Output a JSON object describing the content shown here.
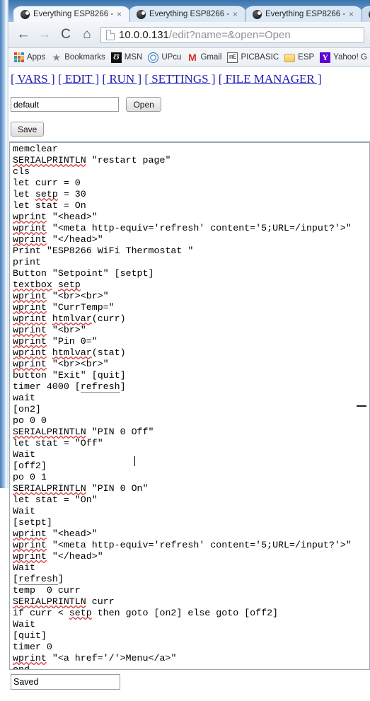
{
  "window": {
    "tabs": [
      {
        "title": "Everything ESP8266 -",
        "favicon": "esp8266-favicon",
        "close": "×",
        "active": true
      },
      {
        "title": "Everything ESP8266 -",
        "favicon": "esp8266-favicon",
        "close": "×",
        "active": false
      },
      {
        "title": "Everything ESP8266 -",
        "favicon": "esp8266-favicon",
        "close": "×",
        "active": false
      },
      {
        "title": "",
        "favicon": "esp8266-favicon",
        "close": "",
        "active": false
      }
    ]
  },
  "toolbar": {
    "back_icon": "back-arrow-icon",
    "forward_icon": "forward-arrow-icon",
    "reload_icon": "reload-icon",
    "home_icon": "home-icon",
    "back_glyph": "←",
    "forward_glyph": "→",
    "reload_glyph": "C",
    "home_glyph": "⌂",
    "url_host": "10.0.0.131",
    "url_rest": "/edit?name=&open=Open",
    "page_icon": "document-icon"
  },
  "bookmarks": [
    {
      "label": "Apps",
      "icon": "apps-grid-icon"
    },
    {
      "label": "Bookmarks",
      "icon": "star-icon"
    },
    {
      "label": "MSN",
      "icon": "msn-icon",
      "glyph": "Ʊ"
    },
    {
      "label": "UPcu",
      "icon": "upcu-icon"
    },
    {
      "label": "Gmail",
      "icon": "gmail-icon",
      "glyph": "M"
    },
    {
      "label": "PICBASIC",
      "icon": "picbasic-icon",
      "glyph": "mΕ"
    },
    {
      "label": "ESP",
      "icon": "folder-icon"
    },
    {
      "label": "Yahoo! G",
      "icon": "yahoo-icon",
      "glyph": "Y"
    }
  ],
  "page": {
    "nav": {
      "vars": "[ VARS ]",
      "edit": "[ EDIT ]",
      "run": "[ RUN ]",
      "settings": "[ SETTINGS ]",
      "file_manager": "[ FILE MANAGER ]"
    },
    "open_row": {
      "name_value": "default",
      "name_placeholder": "",
      "open_label": "Open"
    },
    "save_label": "Save",
    "status_value": "Saved",
    "status_placeholder": "",
    "code": "memclear\nSERIALPRINTLN \"restart page\"\ncls\nlet curr = 0\nlet setp = 30\nlet stat = On\nwprint \"<head>\"\nwprint \"<meta http-equiv='refresh' content='5;URL=/input?'>\"\nwprint \"</head>\"\nPrint \"ESP8266 WiFi Thermostat \"\nprint\nButton \"Setpoint\" [setpt]\ntextbox setp\nwprint \"<br><br>\"\nwprint \"CurrTemp=\"\nwprint htmlvar(curr)\nwprint \"<br>\"\nwprint \"Pin 0=\"\nwprint htmlvar(stat)\nwprint \"<br><br>\"\nbutton \"Exit\" [quit]\ntimer 4000 [refresh]\nwait\n[on2]\npo 0 0\nSERIALPRINTLN \"PIN 0 Off\"\nlet stat = \"Off\"\nWait\n[off2]\npo 0 1\nSERIALPRINTLN \"PIN 0 On\"\nlet stat = \"On\"\nWait\n[setpt]\nwprint \"<head>\"\nwprint \"<meta http-equiv='refresh' content='5;URL=/input?'>\"\nwprint \"</head>\"\nWait\n[refresh]\ntemp  0 curr\nSERIALPRINTLN curr\nif curr < setp then goto [on2] else goto [off2]\nWait\n[quit]\ntimer 0\nwprint \"<a href='/'>Menu</a>\"\nend"
  },
  "colors": {
    "link": "#1b1bb3",
    "spellcheck_underline": "#d43b3b",
    "chrome_blue": "#5a90c4"
  }
}
